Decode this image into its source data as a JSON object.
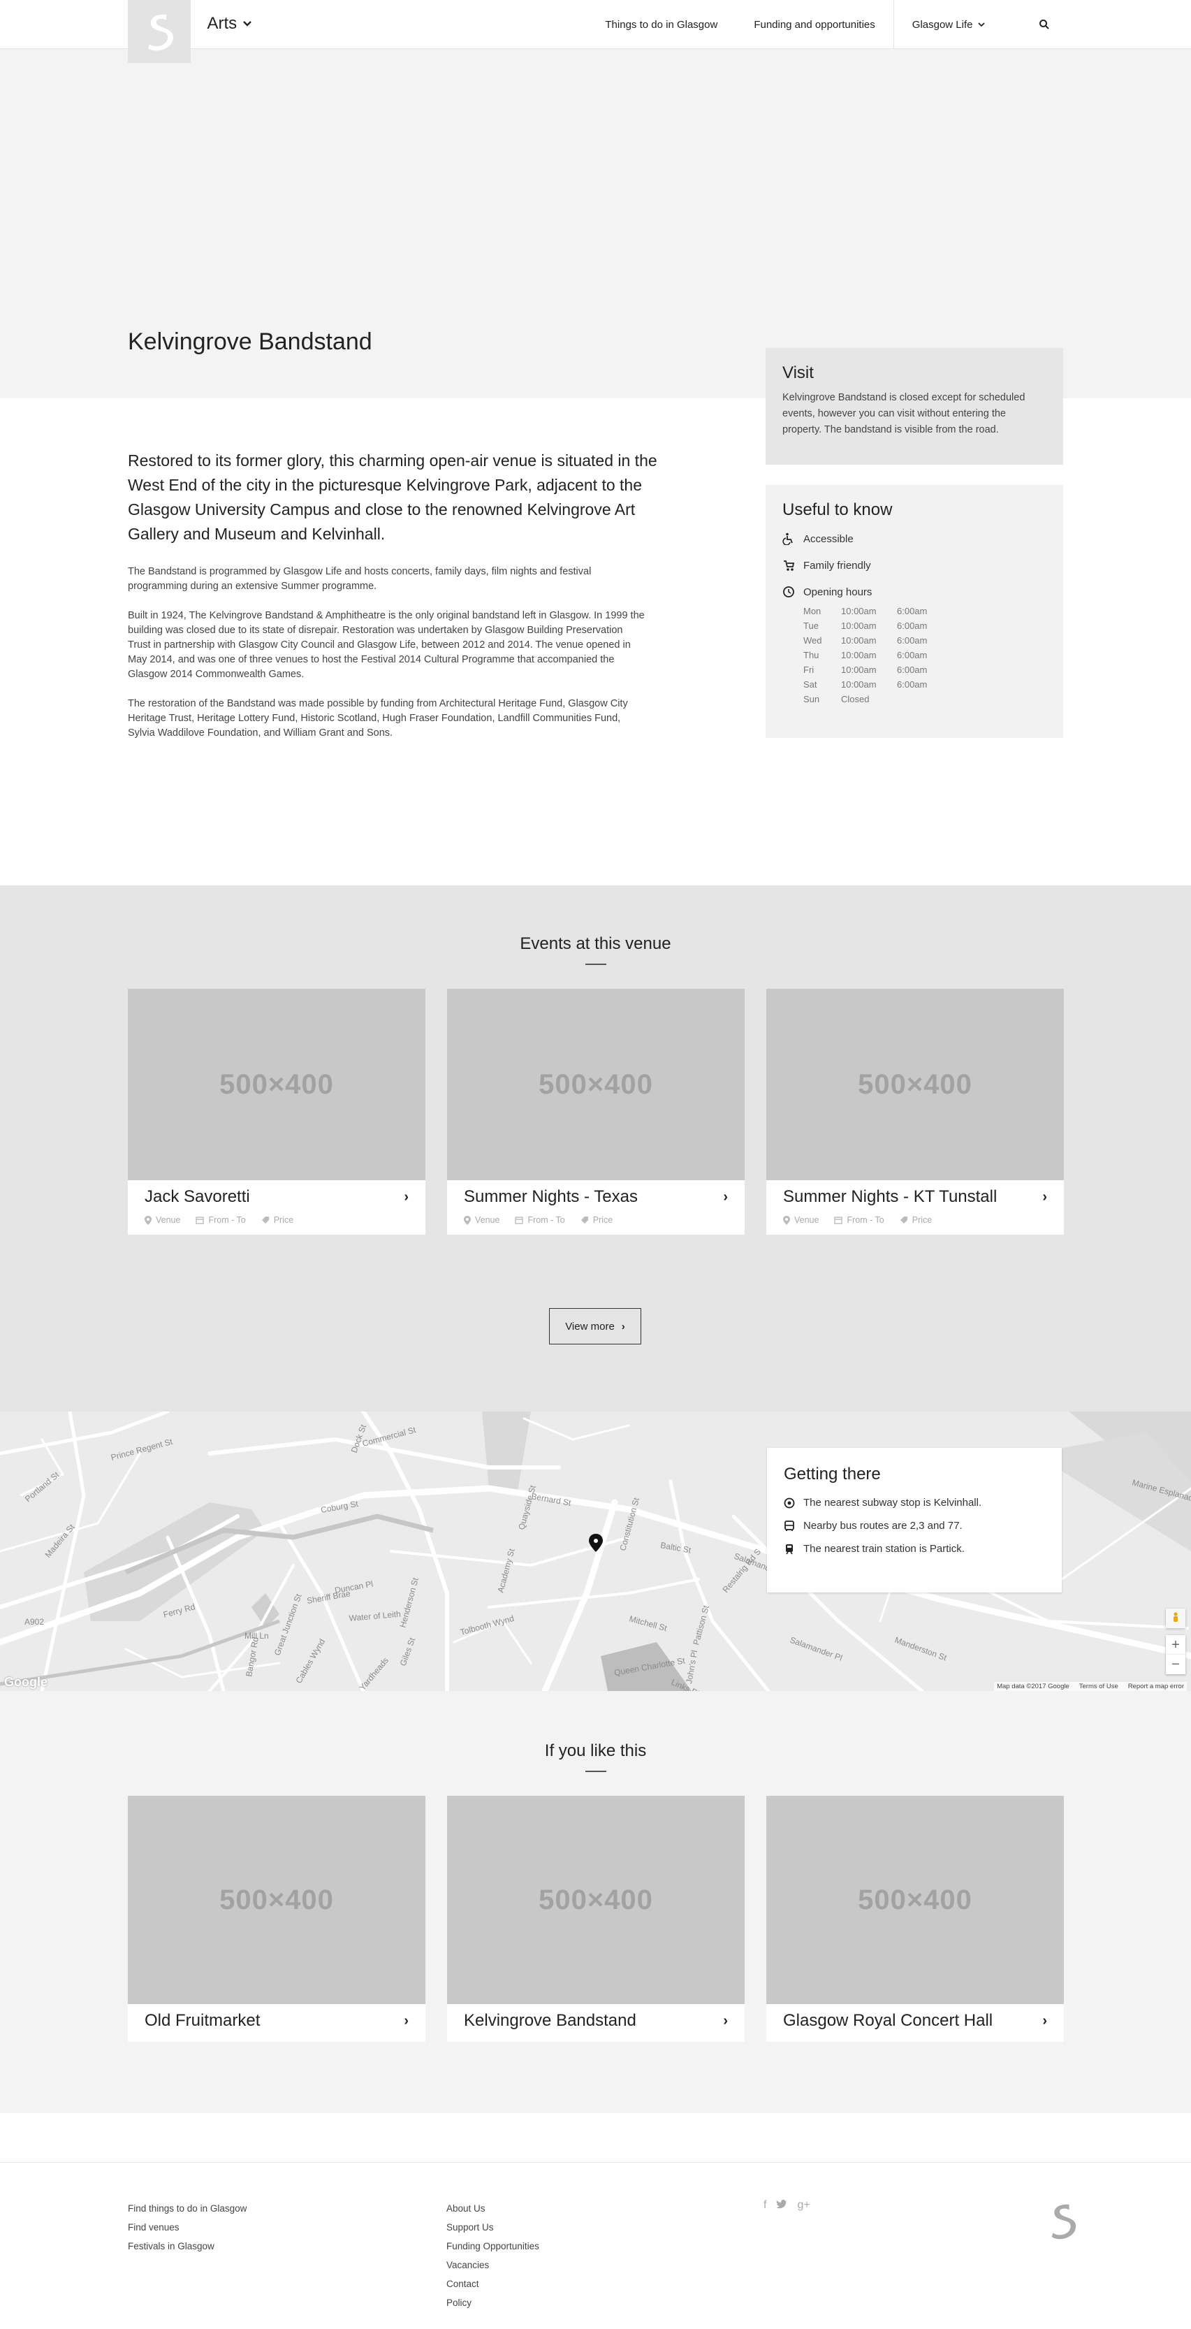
{
  "header": {
    "brand": "Arts",
    "nav": [
      "Things to do in Glasgow",
      "Funding and opportunities",
      "Glasgow Life"
    ]
  },
  "page": {
    "title": "Kelvingrove Bandstand",
    "lead": "Restored to its former glory, this charming open-air venue is situated in the West End of the city in the picturesque Kelvingrove Park, adjacent to the Glasgow University Campus and close to the renowned Kelvingrove Art Gallery and Museum and Kelvinhall.",
    "body": [
      "The Bandstand is programmed by Glasgow Life and hosts concerts, family days, film nights and festival programming during an extensive Summer programme.",
      "Built in 1924, The Kelvingrove Bandstand & Amphitheatre is the only original bandstand left in Glasgow. In 1999 the building was closed due to its state of disrepair. Restoration was undertaken by Glasgow Building Preservation Trust in partnership with Glasgow City Council and Glasgow Life, between 2012 and 2014. The venue opened in May 2014, and was one of three venues to host the Festival 2014 Cultural Programme that accompanied the Glasgow 2014 Commonwealth Games.",
      "The restoration of the Bandstand was made possible by funding from Architectural Heritage Fund, Glasgow City Heritage Trust, Heritage Lottery Fund, Historic Scotland, Hugh Fraser Foundation, Landfill Communities Fund, Sylvia Waddilove Foundation, and William Grant and Sons."
    ]
  },
  "visit": {
    "title": "Visit",
    "text": "Kelvingrove Bandstand is closed except for scheduled events, however you can visit without entering the property. The bandstand is visible from the road."
  },
  "useful": {
    "title": "Useful to know",
    "accessible": "Accessible",
    "family": "Family friendly",
    "hours_label": "Opening hours",
    "hours": [
      {
        "day": "Mon",
        "open": "10:00am",
        "close": "6:00am"
      },
      {
        "day": "Tue",
        "open": "10:00am",
        "close": "6:00am"
      },
      {
        "day": "Wed",
        "open": "10:00am",
        "close": "6:00am"
      },
      {
        "day": "Thu",
        "open": "10:00am",
        "close": "6:00am"
      },
      {
        "day": "Fri",
        "open": "10:00am",
        "close": "6:00am"
      },
      {
        "day": "Sat",
        "open": "10:00am",
        "close": "6:00am"
      },
      {
        "day": "Sun",
        "open": "Closed",
        "close": ""
      }
    ]
  },
  "events": {
    "title": "Events at this venue",
    "placeholder": "500×400",
    "meta": {
      "venue": "Venue",
      "date": "From - To",
      "price": "Price"
    },
    "cards": [
      "Jack Savoretti",
      "Summer Nights - Texas",
      "Summer Nights - KT Tunstall"
    ],
    "view_more": "View more"
  },
  "map": {
    "title": "Getting there",
    "subway": "The nearest subway stop is Kelvinhall.",
    "bus": "Nearby bus routes are 2,3 and 77.",
    "train": "The nearest train station is Partick.",
    "data": "Map data ©2017 Google",
    "terms": "Terms of Use",
    "report": "Report a map error",
    "google": "Google",
    "streets": [
      "Commercial St",
      "Bernard St",
      "Baltic St",
      "Salamander St",
      "Ferry Rd",
      "Water of Leith",
      "Coburg St",
      "Sheriff Brae",
      "Tolbooth Wynd",
      "Henderson St",
      "Queen Charlotte St",
      "Mitchell St",
      "Constitution St",
      "Great Junction St",
      "Cables Wynd",
      "Yardheads",
      "Mill Ln",
      "Giles St",
      "Links Pl",
      "Pattison St",
      "Salamander Pl",
      "Marine Esplanade",
      "Portland St",
      "Prince Regent St",
      "Madeira St",
      "Duncan Pl",
      "Dock St",
      "Bangor Rd",
      "A902",
      "Restalrig Rd S",
      "Quayside St",
      "Academy St",
      "John's Pl",
      "Manderston St"
    ]
  },
  "related": {
    "title": "If you like this",
    "cards": [
      "Old Fruitmarket",
      "Kelvingrove Bandstand",
      "Glasgow Royal Concert Hall"
    ]
  },
  "footer": {
    "col1": [
      "Find things to do in Glasgow",
      "Find venues",
      "Festivals in Glasgow"
    ],
    "col2": [
      "About Us",
      "Support Us",
      "Funding Opportunities",
      "Vacancies",
      "Contact",
      "Policy"
    ]
  }
}
